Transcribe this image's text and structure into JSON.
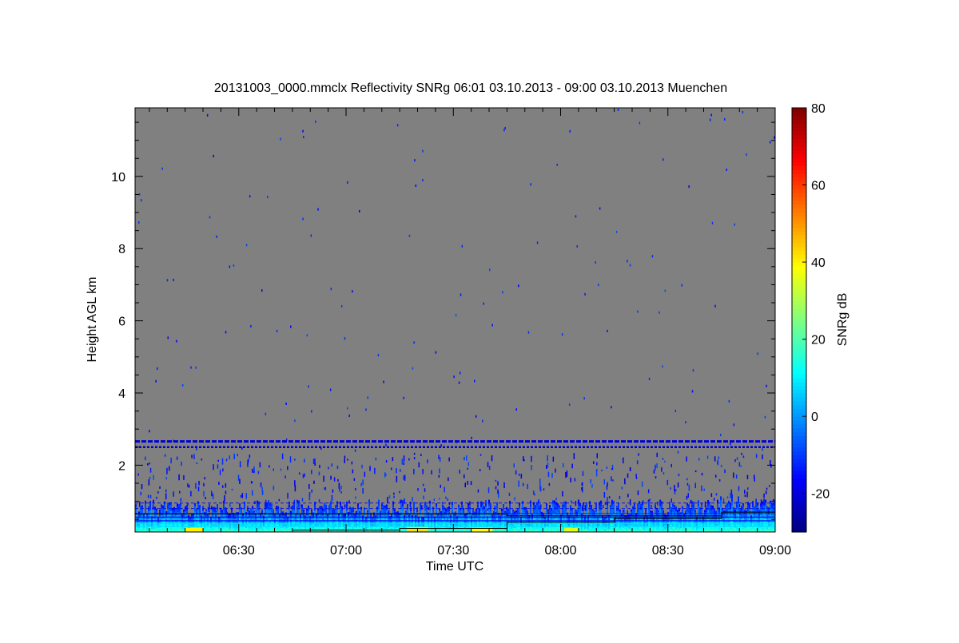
{
  "chart_data": {
    "type": "heatmap",
    "title": "20131003_0000.mmclx Reflectivity SNRg   06:01 03.10.2013 - 09:00 03.10.2013 Muenchen",
    "xlabel": "Time UTC",
    "ylabel": "Height AGL km",
    "x_range_utc": [
      "06:01",
      "09:00"
    ],
    "y_range_km": [
      0.15,
      11.9
    ],
    "x_ticks": [
      "06:30",
      "07:00",
      "07:30",
      "08:00",
      "08:30",
      "09:00"
    ],
    "y_ticks": [
      2,
      4,
      6,
      8,
      10
    ],
    "background": "#808080",
    "colorbar": {
      "label": "SNRg dB",
      "range": [
        -30,
        80
      ],
      "ticks": [
        -20,
        0,
        20,
        40,
        60,
        80
      ],
      "colors": [
        "#00007f",
        "#0000ff",
        "#007fff",
        "#00ffff",
        "#7fff7f",
        "#ffff00",
        "#ff7f00",
        "#ff0000",
        "#7f0000"
      ]
    },
    "features": {
      "noise_bands_km": [
        2.66,
        2.5
      ],
      "boundary_layer_top_km": [
        {
          "time": "06:01",
          "height": 0.65
        },
        {
          "time": "07:45",
          "height": 0.6
        },
        {
          "time": "08:45",
          "height": 0.7
        },
        {
          "time": "09:00",
          "height": 0.9
        }
      ],
      "lower_line_km": [
        {
          "time": "06:45",
          "height": 0.2
        },
        {
          "time": "07:15",
          "height": 0.25
        },
        {
          "time": "07:45",
          "height": 0.42
        },
        {
          "time": "08:15",
          "height": 0.52
        },
        {
          "time": "08:45",
          "height": 0.7
        },
        {
          "time": "09:00",
          "height": 0.72
        }
      ],
      "high_snr_patches": [
        {
          "time_start": "06:15",
          "time_end": "06:20",
          "height_km": 0.2,
          "snr_db": 40
        },
        {
          "time_start": "07:17",
          "time_end": "07:23",
          "height_km": 0.22,
          "snr_db": 42
        },
        {
          "time_start": "07:35",
          "time_end": "07:41",
          "height_km": 0.2,
          "snr_db": 38
        },
        {
          "time_start": "08:01",
          "time_end": "08:05",
          "height_km": 0.2,
          "snr_db": 35
        }
      ]
    }
  }
}
